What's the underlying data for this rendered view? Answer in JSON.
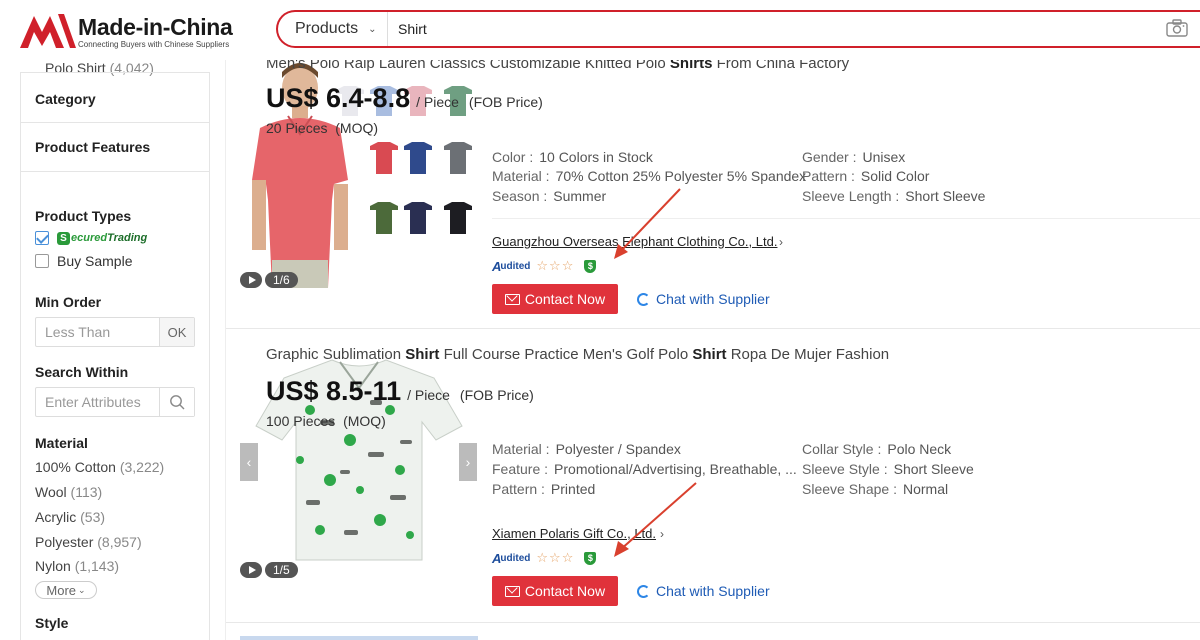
{
  "header": {
    "logo_text": "Made-in-China",
    "logo_tagline": "Connecting Buyers with Chinese Suppliers",
    "search_category": "Products",
    "search_value": "Shirt"
  },
  "sidebar": {
    "top_item": {
      "label": "Polo Shirt",
      "count": "(4,042)"
    },
    "category_title": "Category",
    "features_title": "Product Features",
    "product_types_title": "Product Types",
    "secured_trading": {
      "s": "S",
      "ecured": "ecured",
      "trading": "Trading"
    },
    "buy_sample": "Buy Sample",
    "min_order_title": "Min Order",
    "min_order_placeholder": "Less Than",
    "ok_label": "OK",
    "search_within_title": "Search Within",
    "search_within_placeholder": "Enter Attributes",
    "material_title": "Material",
    "materials": [
      {
        "label": "100% Cotton",
        "count": "(3,222)"
      },
      {
        "label": "Wool",
        "count": "(113)"
      },
      {
        "label": "Acrylic",
        "count": "(53)"
      },
      {
        "label": "Polyester",
        "count": "(8,957)"
      },
      {
        "label": "Nylon",
        "count": "(1,143)"
      }
    ],
    "more_label": "More",
    "style_title": "Style"
  },
  "products": [
    {
      "title_parts": [
        "Men's Polo Ralp Lauren Classics Customizable Knitted Polo ",
        "Shirts",
        " From China Factory"
      ],
      "price": "US$ 6.4-8.8",
      "unit": "/ Piece",
      "fob": "(FOB Price)",
      "moq_qty": "20 Pieces",
      "moq_label": "(MOQ)",
      "attrs_left": [
        {
          "k": "Color :",
          "v": "10 Colors in Stock"
        },
        {
          "k": "Material :",
          "v": "70% Cotton 25% Polyester 5% Spandex"
        },
        {
          "k": "Season :",
          "v": "Summer"
        }
      ],
      "attrs_right": [
        {
          "k": "Gender :",
          "v": "Unisex"
        },
        {
          "k": "Pattern :",
          "v": "Solid Color"
        },
        {
          "k": "Sleeve Length :",
          "v": "Short Sleeve"
        }
      ],
      "supplier": "Guangzhou Overseas Elephant Clothing Co., Ltd.",
      "audited": "udited",
      "audited_a": "A",
      "stars": "☆☆☆",
      "contact": "Contact Now",
      "chat": "Chat with Supplier",
      "image_counter": "1/6"
    },
    {
      "title_parts": [
        "Graphic Sublimation ",
        "Shirt",
        " Full Course Practice Men's Golf Polo ",
        "Shirt",
        " Ropa De Mujer Fashion"
      ],
      "price": "US$ 8.5-11",
      "unit": "/ Piece",
      "fob": "(FOB Price)",
      "moq_qty": "100 Pieces",
      "moq_label": "(MOQ)",
      "attrs_left": [
        {
          "k": "Material :",
          "v": "Polyester / Spandex"
        },
        {
          "k": "Feature :",
          "v": "Promotional/Advertising, Breathable, ..."
        },
        {
          "k": "Pattern :",
          "v": "Printed"
        }
      ],
      "attrs_right": [
        {
          "k": "Collar Style :",
          "v": "Polo Neck"
        },
        {
          "k": "Sleeve Style :",
          "v": "Short Sleeve"
        },
        {
          "k": "Sleeve Shape :",
          "v": "Normal"
        }
      ],
      "supplier": "Xiamen Polaris Gift Co., Ltd.",
      "audited": "udited",
      "audited_a": "A",
      "stars": "☆☆☆",
      "contact": "Contact Now",
      "chat": "Chat with Supplier",
      "image_counter": "1/5"
    }
  ],
  "colors": {
    "brand_red": "#d0202a",
    "button_red": "#e0323b",
    "link_blue": "#1e5bb5",
    "secured_green": "#2a9a3a",
    "annotation_arrow": "#d9402e"
  },
  "swatch_colors": [
    "#e9e9ee",
    "#a9bde0",
    "#e9b5bd",
    "#6f9f82",
    "#d94a52",
    "#2f4a8c",
    "#6c7075",
    "#4c6a3a",
    "#2a2f52",
    "#1d1d22"
  ]
}
